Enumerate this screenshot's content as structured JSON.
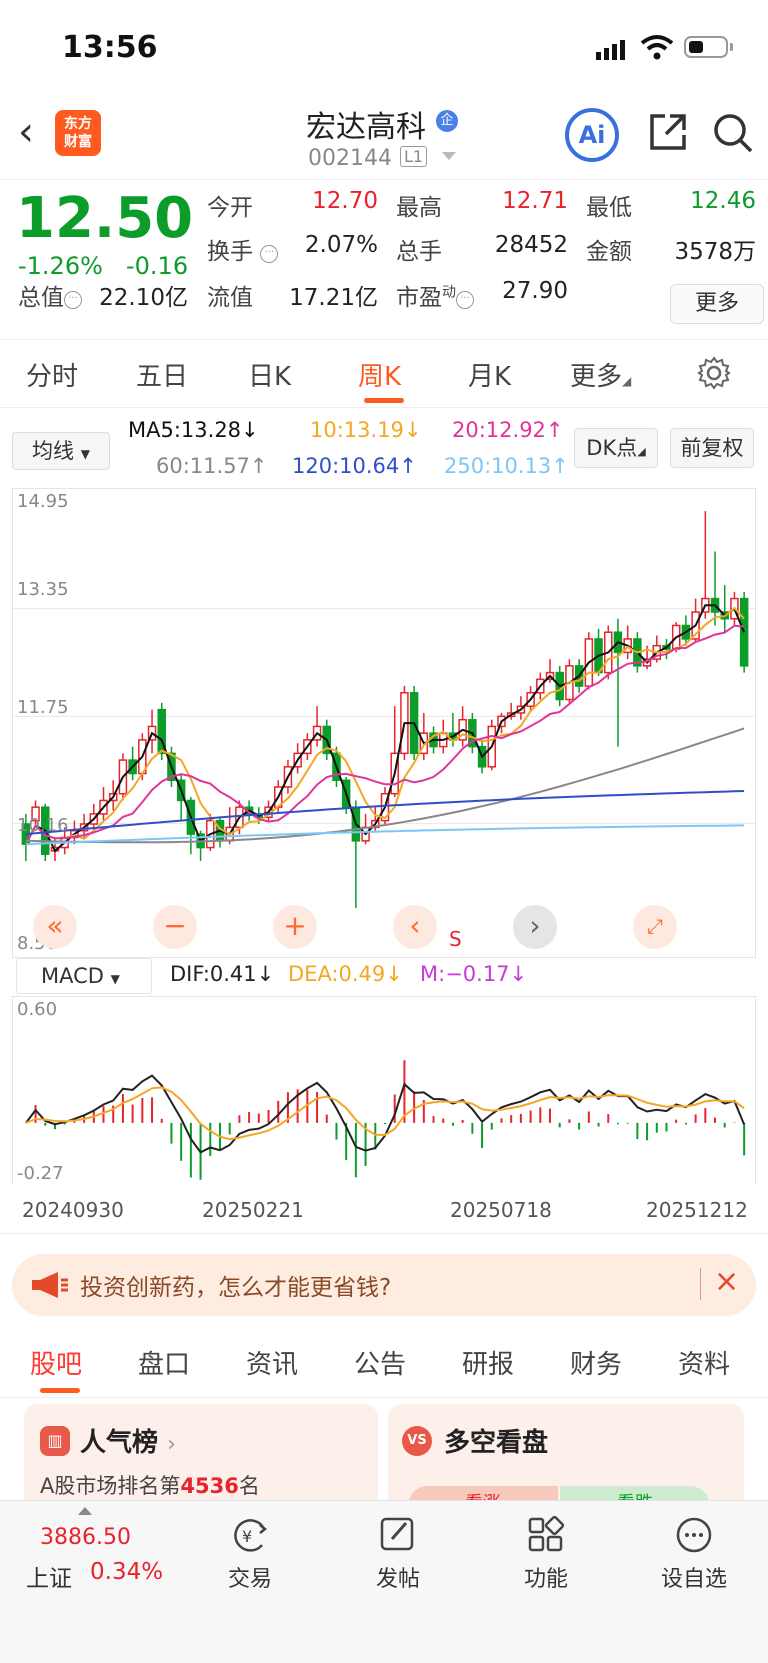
{
  "status": {
    "time": "13:56"
  },
  "header": {
    "stock_name": "宏达高科",
    "stock_code": "002144",
    "level": "L1",
    "logo_text_1": "东方",
    "logo_text_2": "财富",
    "ai_label": "Ai",
    "enterprise_badge": "企"
  },
  "quote": {
    "price": "12.50",
    "change_pct": "-1.26%",
    "change": "-0.16",
    "fields": [
      {
        "label": "今开",
        "value": "12.70"
      },
      {
        "label": "最高",
        "value": "12.71"
      },
      {
        "label": "最低",
        "value": "12.46"
      },
      {
        "label": "换手",
        "value": "2.07%"
      },
      {
        "label": "总手",
        "value": "28452"
      },
      {
        "label": "金额",
        "value": "3578万"
      },
      {
        "label": "总值",
        "value": "22.10亿"
      },
      {
        "label": "流值",
        "value": "17.21亿"
      },
      {
        "label": "市盈",
        "label_sup": "动",
        "value": "27.90"
      }
    ],
    "more_label": "更多"
  },
  "tabs": [
    "分时",
    "五日",
    "日K",
    "周K",
    "月K",
    "更多"
  ],
  "ma_bar": {
    "select": "均线",
    "ma5": "MA5:13.28↓",
    "ma10": "10:13.19↓",
    "ma20": "20:12.92↑",
    "ma60": "60:11.57↑",
    "ma120": "120:10.64↑",
    "ma250": "250:10.13↑",
    "dk": "DK点",
    "adjust": "前复权",
    "colors": {
      "ma5": "#111111",
      "ma10": "#f5a623",
      "ma20": "#e0349c",
      "ma60": "#888888",
      "ma120": "#2f4fc9",
      "ma250": "#7cc7f5"
    }
  },
  "kchart": {
    "y_labels": [
      "14.95",
      "13.35",
      "11.75",
      "10.16",
      "8.56"
    ],
    "s_marker": "S"
  },
  "macd": {
    "select": "MACD",
    "dif": "DIF:0.41↓",
    "dea": "DEA:0.49↓",
    "m": "M:−0.17↓",
    "y_top": "0.60",
    "y_bottom": "-0.27"
  },
  "dates": [
    "20240930",
    "20250221",
    "20250718",
    "20251212"
  ],
  "banner": {
    "text": "投资创新药，怎么才能更省钱?"
  },
  "content_tabs": [
    "股吧",
    "盘口",
    "资讯",
    "公告",
    "研报",
    "财务",
    "资料"
  ],
  "cards": {
    "popularity_title": "人气榜",
    "popularity_prefix": "A股市场排名第",
    "popularity_rank": "4536",
    "popularity_suffix": "名",
    "duokong_title": "多空看盘",
    "bull": "看涨",
    "bear": "看跌"
  },
  "bottom": {
    "index_value": "3886.50",
    "index_name": "上证",
    "index_pct": "0.34%",
    "trade": "交易",
    "post": "发帖",
    "func": "功能",
    "watch": "设自选"
  },
  "chart_data": {
    "type": "candlestick",
    "ylim": [
      8.56,
      14.95
    ],
    "candles": [
      [
        10.15,
        9.85,
        10.3,
        9.6
      ],
      [
        10.2,
        10.4,
        10.5,
        10.1
      ],
      [
        10.4,
        9.7,
        10.45,
        9.6
      ],
      [
        9.75,
        9.8,
        9.95,
        9.6
      ],
      [
        9.8,
        9.95,
        10.1,
        9.7
      ],
      [
        9.95,
        10.05,
        10.2,
        9.85
      ],
      [
        10.05,
        10.15,
        10.3,
        9.95
      ],
      [
        10.15,
        10.3,
        10.45,
        10.05
      ],
      [
        10.3,
        10.5,
        10.7,
        10.2
      ],
      [
        10.5,
        10.6,
        10.8,
        10.35
      ],
      [
        10.6,
        11.1,
        11.2,
        10.5
      ],
      [
        11.1,
        10.9,
        11.3,
        10.8
      ],
      [
        10.9,
        11.4,
        11.5,
        10.8
      ],
      [
        11.4,
        11.6,
        11.85,
        11.2
      ],
      [
        11.85,
        11.2,
        11.95,
        11.1
      ],
      [
        11.2,
        10.8,
        11.3,
        10.7
      ],
      [
        10.8,
        10.5,
        10.9,
        10.2
      ],
      [
        10.5,
        10.0,
        10.55,
        9.7
      ],
      [
        10.0,
        9.8,
        10.05,
        9.6
      ],
      [
        9.8,
        10.2,
        10.3,
        9.75
      ],
      [
        10.2,
        9.9,
        10.25,
        9.8
      ],
      [
        9.9,
        10.1,
        10.4,
        9.85
      ],
      [
        10.1,
        10.4,
        10.5,
        10.0
      ],
      [
        10.4,
        10.3,
        10.5,
        10.2
      ],
      [
        10.3,
        10.25,
        10.4,
        10.15
      ],
      [
        10.25,
        10.4,
        10.5,
        10.2
      ],
      [
        10.4,
        10.7,
        10.8,
        10.3
      ],
      [
        10.7,
        11.0,
        11.1,
        10.6
      ],
      [
        11.0,
        11.2,
        11.35,
        10.9
      ],
      [
        11.2,
        11.4,
        11.5,
        11.1
      ],
      [
        11.4,
        11.6,
        11.9,
        11.3
      ],
      [
        11.6,
        11.2,
        11.7,
        11.1
      ],
      [
        11.2,
        10.8,
        11.3,
        10.7
      ],
      [
        10.8,
        10.4,
        10.85,
        10.3
      ],
      [
        10.4,
        9.9,
        10.5,
        8.9
      ],
      [
        9.9,
        10.1,
        10.3,
        9.85
      ],
      [
        10.1,
        10.2,
        10.4,
        10.05
      ],
      [
        10.2,
        10.6,
        10.7,
        10.15
      ],
      [
        10.6,
        11.2,
        11.9,
        10.55
      ],
      [
        11.2,
        12.1,
        12.2,
        11.1
      ],
      [
        12.1,
        11.2,
        12.2,
        11.1
      ],
      [
        11.2,
        11.5,
        11.8,
        11.1
      ],
      [
        11.5,
        11.3,
        11.6,
        11.2
      ],
      [
        11.3,
        11.5,
        11.7,
        11.2
      ],
      [
        11.5,
        11.4,
        11.8,
        11.3
      ],
      [
        11.4,
        11.7,
        11.9,
        11.3
      ],
      [
        11.7,
        11.3,
        11.8,
        11.2
      ],
      [
        11.3,
        11.0,
        11.4,
        10.9
      ],
      [
        11.0,
        11.6,
        11.7,
        10.95
      ],
      [
        11.6,
        11.75,
        11.8,
        11.5
      ],
      [
        11.75,
        11.8,
        11.95,
        11.7
      ],
      [
        11.8,
        11.9,
        12.05,
        11.7
      ],
      [
        11.9,
        12.1,
        12.2,
        11.85
      ],
      [
        12.1,
        12.3,
        12.4,
        12.0
      ],
      [
        12.3,
        12.4,
        12.6,
        12.25
      ],
      [
        12.4,
        12.0,
        12.5,
        11.9
      ],
      [
        12.0,
        12.5,
        12.6,
        11.95
      ],
      [
        12.5,
        12.2,
        12.6,
        12.1
      ],
      [
        12.2,
        12.9,
        13.0,
        12.15
      ],
      [
        12.9,
        12.4,
        13.05,
        12.35
      ],
      [
        12.4,
        13.0,
        13.1,
        12.3
      ],
      [
        13.0,
        12.7,
        13.2,
        11.3
      ],
      [
        12.7,
        12.9,
        13.1,
        12.6
      ],
      [
        12.9,
        12.5,
        13.0,
        12.4
      ],
      [
        12.5,
        12.6,
        12.8,
        12.45
      ],
      [
        12.6,
        12.8,
        12.95,
        12.55
      ],
      [
        12.8,
        12.75,
        12.9,
        12.6
      ],
      [
        12.75,
        13.1,
        13.15,
        12.7
      ],
      [
        13.1,
        12.9,
        13.25,
        12.8
      ],
      [
        12.9,
        13.3,
        13.5,
        12.85
      ],
      [
        13.3,
        13.5,
        14.8,
        13.2
      ],
      [
        13.5,
        13.3,
        14.2,
        13.1
      ],
      [
        13.3,
        13.2,
        13.7,
        13.0
      ],
      [
        13.2,
        13.5,
        13.6,
        13.1
      ],
      [
        13.5,
        12.5,
        13.6,
        12.4
      ]
    ],
    "macd_hist_range": [
      -0.27,
      0.6
    ]
  }
}
